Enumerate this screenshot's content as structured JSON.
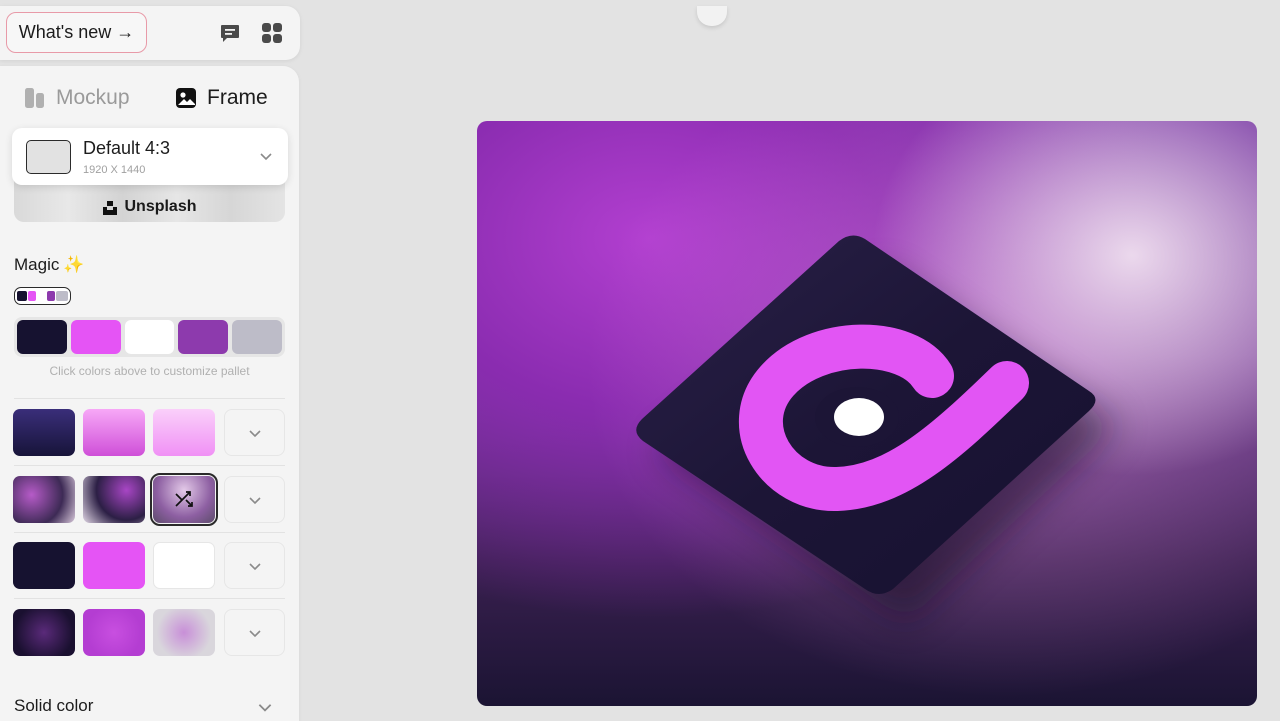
{
  "header": {
    "whats_new": "What's new →",
    "icons": [
      "feedback-icon",
      "apps-grid-icon"
    ]
  },
  "tabs": {
    "mockup": "Mockup",
    "frame": "Frame",
    "active": "frame"
  },
  "preset": {
    "name": "Default 4:3",
    "size": "1920 X 1440"
  },
  "unsplash": {
    "label": "Unsplash"
  },
  "magic": {
    "label": "Magic",
    "emoji": "✨",
    "palette": [
      "#161230",
      "#e554f5",
      "#ffffff",
      "#8d3aad",
      "#bdbcc8"
    ],
    "hint": "Click colors above to customize pallet"
  },
  "backgrounds": {
    "rows": [
      [
        "linear-gradient(180deg,#3a2e7a,#171439)",
        "linear-gradient(180deg,#f7a8f7,#cf4fd8)",
        "linear-gradient(180deg,#fad0fa,#f090f5)"
      ],
      [
        "radial-gradient(circle at 30% 40%,#b65bc8,#3d2a55 60%,#d8c8da)",
        "radial-gradient(circle at 70% 30%,#a846c5,#2c1f45 55%,#e2d8e6)",
        "radial-gradient(circle at 50% 30%,#e3c9e8,#8d5fa2 60%,#5c4c6a)"
      ],
      [
        "#161230",
        "#e554f5",
        "#ffffff"
      ],
      [
        "radial-gradient(circle at 50% 50%,#5a2a7a,#1a1030 75%)",
        "radial-gradient(circle at 50% 50%,#c84fe0,#b43dd2 70%)",
        "radial-gradient(circle at 50% 50%,#c88fd8,#d9d6dc 70%)"
      ]
    ],
    "selected_row": 1,
    "selected_col": 2
  },
  "solid": {
    "label": "Solid color"
  },
  "canvas": {
    "tile_color": "#1c1536",
    "logo_color": "#e255f4",
    "dot_color": "#ffffff"
  }
}
